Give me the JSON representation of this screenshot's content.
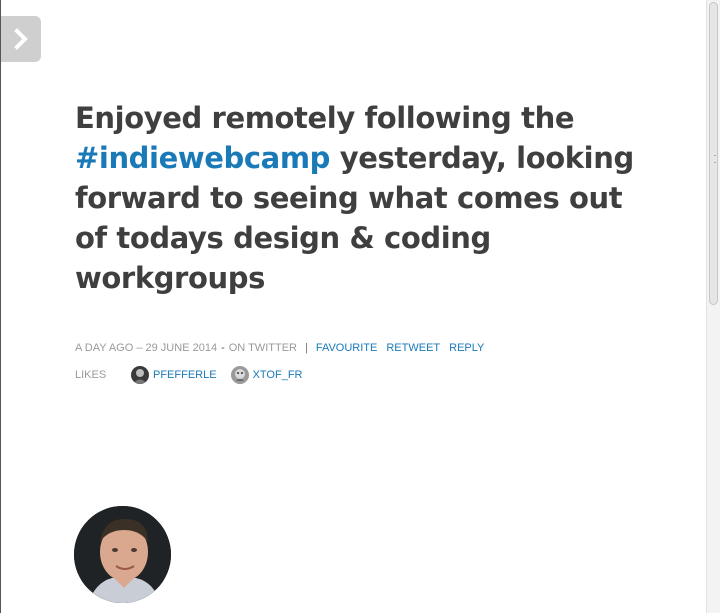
{
  "nav": {
    "icon": "chevron-right-icon"
  },
  "post": {
    "text_before": "Enjoyed remotely following the ",
    "hashtag": "#indiewebcamp",
    "text_after": " yesterday, looking forward to seeing what comes out of todays design & coding workgroups"
  },
  "meta": {
    "time": "A DAY AGO – 29 JUNE 2014",
    "dash": "-",
    "source": "ON TWITTER",
    "bar": "|",
    "actions": {
      "favourite": "FAVOURITE",
      "retweet": "RETWEET",
      "reply": "REPLY"
    }
  },
  "likes": {
    "label": "LIKES",
    "users": [
      {
        "name": "PFEFFERLE"
      },
      {
        "name": "XTOF_FR"
      }
    ]
  },
  "colors": {
    "link": "#1a7ab8",
    "text": "#3f3f3f",
    "muted": "#9a9a9a"
  }
}
